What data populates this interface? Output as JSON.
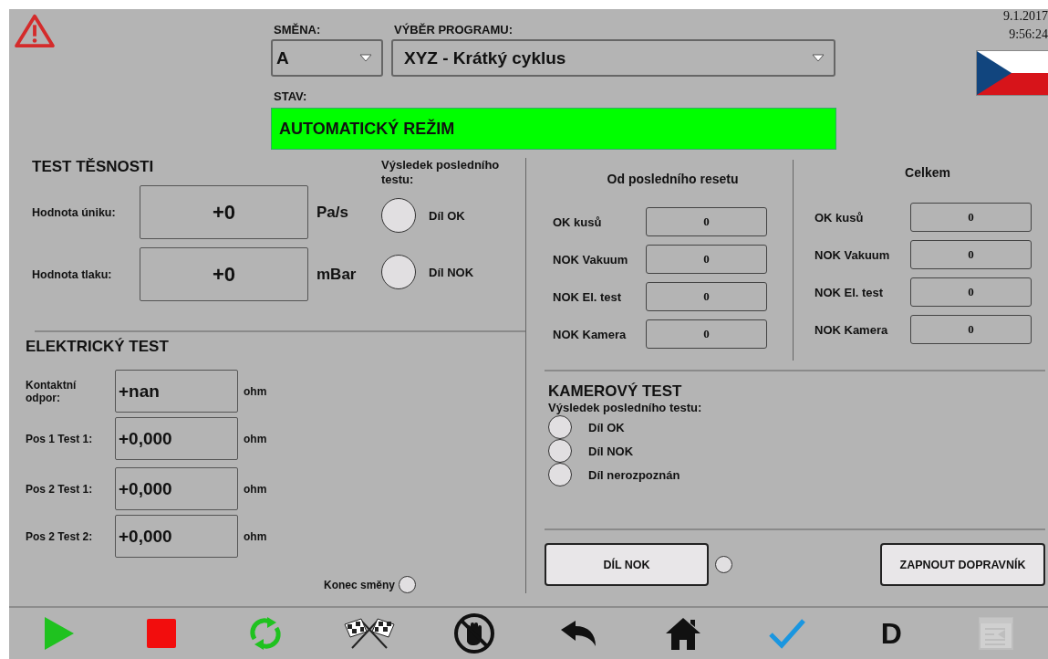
{
  "shift": {
    "label": "SMĚNA:",
    "value": "A"
  },
  "program": {
    "label": "VÝBĚR PROGRAMU:",
    "value": "XYZ - Krátký cyklus"
  },
  "status": {
    "label": "STAV:",
    "value": "AUTOMATICKÝ REŽIM"
  },
  "clock": {
    "date": "9.1.2017",
    "time": "9:56:24"
  },
  "leak_test": {
    "title": "TEST TĚSNOSTI",
    "result_label": "Výsledek posledního testu:",
    "measurements": [
      {
        "label": "Hodnota úniku:",
        "value": "+0",
        "unit": "Pa/s"
      },
      {
        "label": "Hodnota tlaku:",
        "value": "+0",
        "unit": "mBar"
      }
    ],
    "results": [
      {
        "label": "Díl OK",
        "on": false
      },
      {
        "label": "Díl NOK",
        "on": false
      }
    ]
  },
  "electrical_test": {
    "title": "ELEKTRICKÝ TEST",
    "rows": [
      {
        "label": "Kontaktní odpor:",
        "value": "+nan",
        "unit": "ohm"
      },
      {
        "label": "Pos 1 Test 1:",
        "value": "+0,000",
        "unit": "ohm"
      },
      {
        "label": "Pos 2 Test 1:",
        "value": "+0,000",
        "unit": "ohm"
      },
      {
        "label": "Pos 2 Test 2:",
        "value": "+0,000",
        "unit": "ohm"
      }
    ]
  },
  "shift_end": {
    "label": "Konec směny",
    "on": false
  },
  "counters": [
    {
      "title": "Od posledního resetu",
      "rows": [
        {
          "label": "OK kusů",
          "value": "0"
        },
        {
          "label": "NOK Vakuum",
          "value": "0"
        },
        {
          "label": "NOK El. test",
          "value": "0"
        },
        {
          "label": "NOK Kamera",
          "value": "0"
        }
      ]
    },
    {
      "title": "Celkem",
      "rows": [
        {
          "label": "OK kusů",
          "value": "0"
        },
        {
          "label": "NOK Vakuum",
          "value": "0"
        },
        {
          "label": "NOK El. test",
          "value": "0"
        },
        {
          "label": "NOK Kamera",
          "value": "0"
        }
      ]
    }
  ],
  "camera_test": {
    "title": "KAMEROVÝ TEST",
    "result_label": "Výsledek posledního testu:",
    "results": [
      {
        "label": "Díl OK",
        "on": false
      },
      {
        "label": "Díl NOK",
        "on": false
      },
      {
        "label": "Díl nerozpoznán",
        "on": false
      }
    ]
  },
  "part_nok_button": {
    "label": "DÍL NOK",
    "lamp_on": false
  },
  "conveyor_button": {
    "label": "ZAPNOUT DOPRAVNÍK"
  },
  "toolbar": [
    {
      "kind": "play",
      "disabled": false
    },
    {
      "kind": "stop",
      "disabled": false
    },
    {
      "kind": "refresh",
      "disabled": false
    },
    {
      "kind": "flags",
      "disabled": false
    },
    {
      "kind": "hand",
      "disabled": false
    },
    {
      "kind": "back",
      "disabled": false
    },
    {
      "kind": "home",
      "disabled": false
    },
    {
      "kind": "check",
      "disabled": false
    },
    {
      "kind": "text",
      "label": "D",
      "disabled": false
    },
    {
      "kind": "screen",
      "disabled": true
    }
  ]
}
